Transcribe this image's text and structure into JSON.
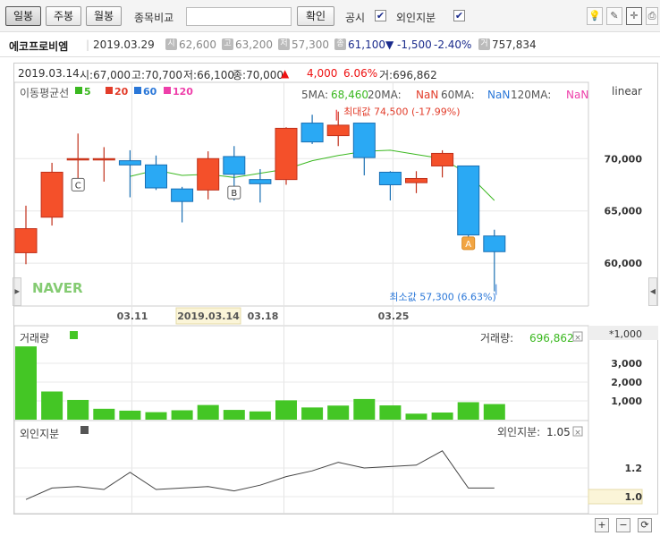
{
  "toolbar": {
    "period_buttons": [
      "일봉",
      "주봉",
      "월봉"
    ],
    "compare_label": "종목비교",
    "confirm_label": "확인",
    "disclosure_label": "공시",
    "foreign_label": "외인지분",
    "check_mark": "✔"
  },
  "info": {
    "name": "에코프로비엠",
    "date": "2019.03.29",
    "open_badge": "시",
    "open": "62,600",
    "high_badge": "고",
    "high": "63,200",
    "low_badge": "저",
    "low": "57,300",
    "close_badge": "종",
    "close": "61,100",
    "change": "▼ -1,500",
    "change_pct": "-2.40%",
    "vol_badge": "거",
    "volume": "757,834"
  },
  "hover": {
    "date": "2019.03.14",
    "open": "시:67,000",
    "high": "고:70,700",
    "low": "저:66,100",
    "close": "종:70,000",
    "arrow": "▲",
    "change": "4,000",
    "change_pct": "6.06%",
    "volume": "거:696,862"
  },
  "colors": {
    "up": "#f4502a",
    "down": "#2aa9f4",
    "volume": "#44c625",
    "ma5": "#3bb820",
    "ma20": "#e23c2a",
    "ma60": "#2a77d8",
    "ma120": "#ee3faa"
  },
  "chart_data": [
    {
      "type": "candlestick",
      "title": "이동평균선",
      "scale_label": "linear",
      "ma_legend": [
        "5",
        "20",
        "60",
        "120"
      ],
      "ma_values": {
        "5MA": "68,460",
        "20MA": "NaN",
        "60MA": "NaN",
        "120MA": "NaN"
      },
      "yticks": [
        60000,
        65000,
        70000
      ],
      "ytick_labels": [
        "60,000",
        "65,000",
        "70,000"
      ],
      "ylim": [
        55900,
        77300
      ],
      "xtick_labels": [
        "03.11",
        "2019.03.14",
        "03.18",
        "03.25"
      ],
      "max_label": "최대값 74,500 (-17.99%)",
      "min_label": "최소값 57,300 (6.63%)",
      "markers": [
        "C",
        "B",
        "A"
      ],
      "logo": "NAVER",
      "candles": [
        {
          "o": 61000,
          "h": 65500,
          "l": 59900,
          "c": 63300
        },
        {
          "o": 64400,
          "h": 69600,
          "l": 63600,
          "c": 68700
        },
        {
          "o": 70000,
          "h": 72400,
          "l": 68000,
          "c": 70000
        },
        {
          "o": 70000,
          "h": 71100,
          "l": 67800,
          "c": 70000
        },
        {
          "o": 69800,
          "h": 70800,
          "l": 66300,
          "c": 69400
        },
        {
          "o": 69400,
          "h": 70300,
          "l": 67000,
          "c": 67200
        },
        {
          "o": 67100,
          "h": 67300,
          "l": 63900,
          "c": 65900
        },
        {
          "o": 67000,
          "h": 70700,
          "l": 66100,
          "c": 70000
        },
        {
          "o": 70200,
          "h": 71200,
          "l": 66000,
          "c": 68500
        },
        {
          "o": 68000,
          "h": 69000,
          "l": 65800,
          "c": 67600
        },
        {
          "o": 68000,
          "h": 73000,
          "l": 67500,
          "c": 72900
        },
        {
          "o": 73400,
          "h": 74200,
          "l": 71400,
          "c": 71600
        },
        {
          "o": 72200,
          "h": 74500,
          "l": 71200,
          "c": 73200
        },
        {
          "o": 73400,
          "h": 73400,
          "l": 68400,
          "c": 70100
        },
        {
          "o": 68700,
          "h": 68800,
          "l": 66000,
          "c": 67500
        },
        {
          "o": 67700,
          "h": 68800,
          "l": 66700,
          "c": 68100
        },
        {
          "o": 69300,
          "h": 70800,
          "l": 68200,
          "c": 70500
        },
        {
          "o": 69300,
          "h": 69300,
          "l": 62500,
          "c": 62700
        },
        {
          "o": 62600,
          "h": 63200,
          "l": 57300,
          "c": 61100
        }
      ],
      "ma5": [
        null,
        null,
        null,
        null,
        68300,
        68900,
        68400,
        68500,
        68200,
        68600,
        69000,
        69800,
        70300,
        70700,
        70800,
        70400,
        70000,
        68500,
        66000
      ]
    },
    {
      "type": "bar",
      "title": "거래량",
      "unit_label": "*1,000",
      "value_label": "거래량:",
      "value": "696,862",
      "ytick_labels": [
        "1,000",
        "2,000",
        "3,000"
      ],
      "yticks": [
        1000,
        2000,
        3000
      ],
      "values": [
        3900,
        1500,
        1050,
        580,
        480,
        400,
        500,
        780,
        520,
        440,
        1030,
        650,
        750,
        1100,
        760,
        320,
        380,
        930,
        830
      ]
    },
    {
      "type": "line",
      "title": "외인지분",
      "value_label": "외인지분:",
      "value": "1.05",
      "ytick_labels": [
        "1.2",
        "1.0"
      ],
      "yticks": [
        1.2,
        1.0
      ],
      "values": [
        0.98,
        1.06,
        1.07,
        1.05,
        1.17,
        1.05,
        1.06,
        1.07,
        1.04,
        1.08,
        1.14,
        1.18,
        1.24,
        1.2,
        1.21,
        1.22,
        1.32,
        1.06,
        1.06
      ]
    }
  ]
}
